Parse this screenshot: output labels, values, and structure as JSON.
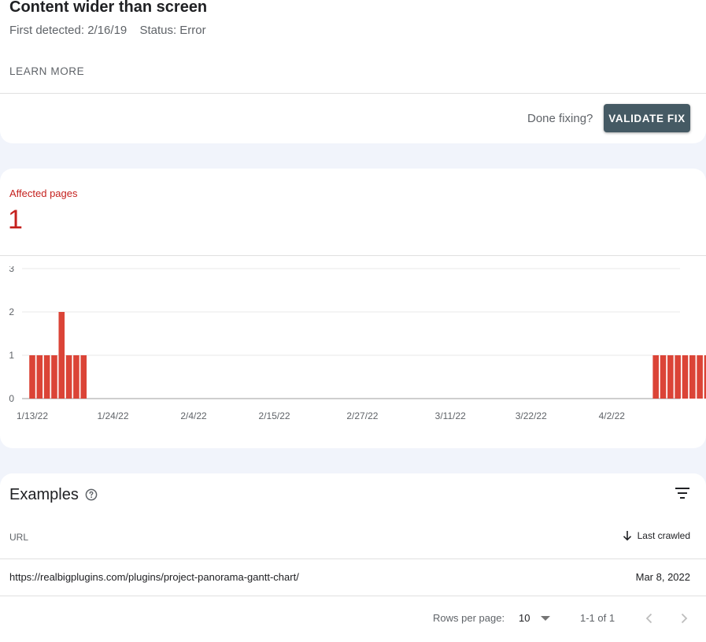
{
  "issue": {
    "title": "Content wider than screen",
    "first_detected": "First detected: 2/16/19",
    "status": "Status: Error",
    "learn_more": "LEARN MORE",
    "done_fixing": "Done fixing?",
    "validate_fix": "VALIDATE FIX"
  },
  "affected": {
    "label": "Affected pages",
    "value": "1"
  },
  "chart_data": {
    "type": "bar",
    "start_date": "2022-01-13",
    "dates": [
      "2022-01-13",
      "2022-01-14",
      "2022-01-15",
      "2022-01-16",
      "2022-01-17",
      "2022-01-18",
      "2022-01-19",
      "2022-01-20",
      "2022-04-08",
      "2022-04-09",
      "2022-04-10",
      "2022-04-11",
      "2022-04-12",
      "2022-04-13",
      "2022-04-14",
      "2022-04-15"
    ],
    "values": [
      1,
      1,
      1,
      1,
      2,
      1,
      1,
      1,
      1,
      1,
      1,
      1,
      1,
      1,
      1,
      1
    ],
    "x_tick_labels": [
      "1/13/22",
      "1/24/22",
      "2/4/22",
      "2/15/22",
      "2/27/22",
      "3/11/22",
      "3/22/22",
      "4/2/22"
    ],
    "x_tick_dates": [
      "2022-01-13",
      "2022-01-24",
      "2022-02-04",
      "2022-02-15",
      "2022-02-27",
      "2022-03-11",
      "2022-03-22",
      "2022-04-02"
    ],
    "y_ticks": [
      0,
      1,
      2,
      3
    ],
    "ylim": [
      0,
      3
    ],
    "grid": true,
    "bar_color": "#db4437"
  },
  "examples": {
    "title": "Examples",
    "help_icon": "help-circle-icon",
    "filter_icon": "filter-icon",
    "col_url": "URL",
    "col_last_crawled": "Last crawled",
    "rows": [
      {
        "url": "https://realbigplugins.com/plugins/project-panorama-gantt-chart/",
        "date": "Mar 8, 2022"
      }
    ],
    "rows_per_page_label": "Rows per page:",
    "rows_per_page_value": "10",
    "range": "1-1 of 1"
  },
  "colors": {
    "accent_error": "#c5221f",
    "button_bg": "#455a64",
    "page_bg": "#f1f4fb"
  }
}
